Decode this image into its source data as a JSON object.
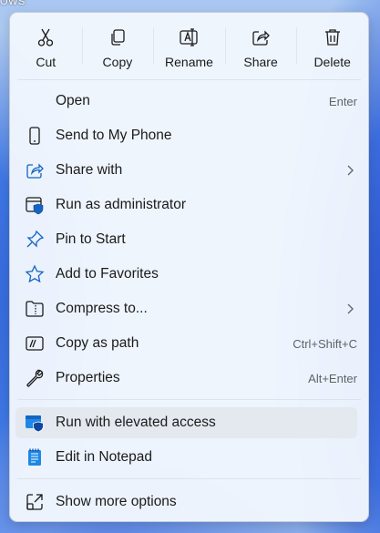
{
  "background_text": "OWS",
  "toolbar": {
    "buttons": [
      {
        "label": "Cut",
        "icon": "scissors-icon"
      },
      {
        "label": "Copy",
        "icon": "copy-icon"
      },
      {
        "label": "Rename",
        "icon": "rename-icon"
      },
      {
        "label": "Share",
        "icon": "share-icon"
      },
      {
        "label": "Delete",
        "icon": "trash-icon"
      }
    ]
  },
  "menu": {
    "items": [
      {
        "label": "Open",
        "shortcut": "Enter",
        "icon": ""
      },
      {
        "label": "Send to My Phone",
        "shortcut": "",
        "icon": "phone-icon"
      },
      {
        "label": "Share with",
        "shortcut": "",
        "icon": "share-with-icon",
        "submenu": true
      },
      {
        "label": "Run as administrator",
        "shortcut": "",
        "icon": "admin-shield-icon"
      },
      {
        "label": "Pin to Start",
        "shortcut": "",
        "icon": "pin-icon"
      },
      {
        "label": "Add to Favorites",
        "shortcut": "",
        "icon": "star-icon"
      },
      {
        "label": "Compress to...",
        "shortcut": "",
        "icon": "zip-folder-icon",
        "submenu": true
      },
      {
        "label": "Copy as path",
        "shortcut": "Ctrl+Shift+C",
        "icon": "path-icon"
      },
      {
        "label": "Properties",
        "shortcut": "Alt+Enter",
        "icon": "wrench-icon"
      },
      {
        "label": "Run with elevated access",
        "shortcut": "",
        "icon": "elevated-access-icon"
      },
      {
        "label": "Edit in Notepad",
        "shortcut": "",
        "icon": "notepad-icon"
      },
      {
        "label": "Show more options",
        "shortcut": "",
        "icon": "more-options-icon"
      }
    ]
  },
  "colors": {
    "accent": "#0f6cbd",
    "menu_background": "#f1f6fd",
    "hover_background": "#e4e9f0",
    "text": "#1b1b1b",
    "shortcut_text": "#5f6368"
  }
}
